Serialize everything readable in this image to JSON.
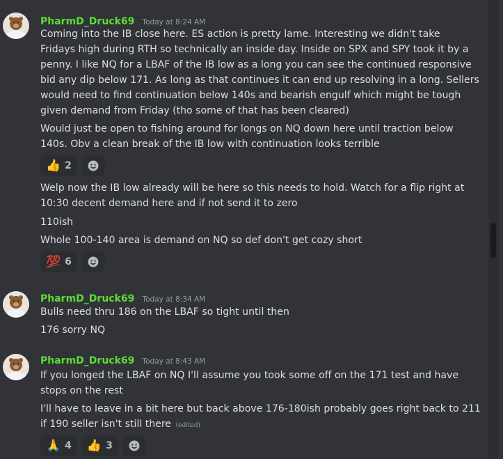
{
  "messages": [
    {
      "username": "PharmD_Druck69",
      "timestamp": "Today at 8:24 AM",
      "lines": [
        "Coming into the IB close here. ES action is pretty lame. Interesting we didn't take",
        "Fridays high during RTH so technically an inside day. Inside on SPX and SPY took it by a",
        "penny. I like NQ for a LBAF of the IB low as a long you can see the continued responsive",
        "bid any dip below 171. As long as that continues it can end up resolving in a long. Sellers",
        "would need to find continuation below 140s and bearish engulf which might be tough",
        "given demand from Friday (tho some of that has been cleared)",
        "Would just be open to fishing around for longs on NQ down here until traction below",
        "140s. Obv a clean break of the IB low with continuation looks terrible"
      ],
      "reactions1": [
        {
          "emoji": "👍",
          "count": "2"
        }
      ],
      "lines2": [
        "Welp now the IB low already will be here so this needs to hold. Watch for a flip right at",
        "10:30 decent demand here and if not send it to zero",
        "110ish",
        "Whole 100-140 area is demand on NQ so def don't get cozy short"
      ],
      "reactions2": [
        {
          "emoji": "💯",
          "count": "6"
        }
      ]
    },
    {
      "username": "PharmD_Druck69",
      "timestamp": "Today at 8:34 AM",
      "lines": [
        "Bulls need thru 186 on the LBAF so tight until then",
        "176 sorry NQ"
      ]
    },
    {
      "username": "PharmD_Druck69",
      "timestamp": "Today at 8:43 AM",
      "lines": [
        "If you longed the LBAF on NQ I'll assume you took some off on the 171 test and have",
        "stops on the rest",
        "I'll have to leave in a bit here but back above 176-180ish probably goes right back to 211",
        "if 190 seller isn't still there"
      ],
      "edited": "(edited)",
      "reactions": [
        {
          "emoji": "🙏",
          "count": "4"
        },
        {
          "emoji": "👍",
          "count": "3"
        }
      ]
    }
  ],
  "icons": {
    "add_reaction": "add-reaction-icon",
    "avatar": "bear-avatar"
  },
  "colors": {
    "background": "#313338",
    "username": "#5ddc34",
    "text": "#dbdee1",
    "reaction_bg": "#2b2d31"
  }
}
